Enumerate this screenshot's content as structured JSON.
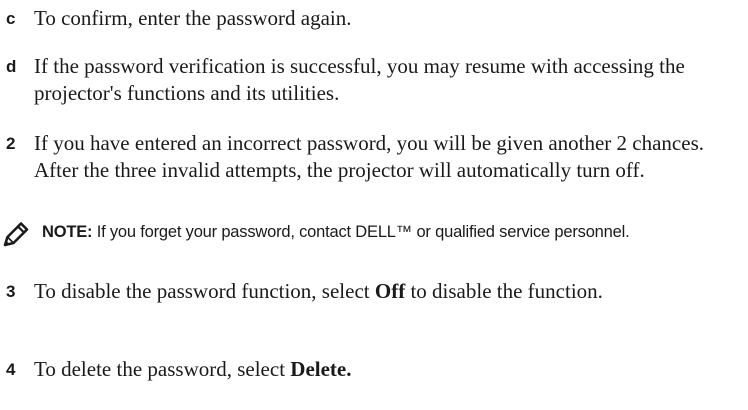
{
  "steps": [
    {
      "marker": "c",
      "text": "To confirm, enter the password again."
    },
    {
      "marker": "d",
      "text": "If the password verification is successful, you may resume with accessing the projector's functions and its utilities."
    },
    {
      "marker": "2",
      "text": "If you have entered an incorrect password, you will be given another 2 chances. After the three invalid attempts, the projector will automatically turn off."
    }
  ],
  "note": {
    "label": "NOTE:",
    "text": "If you forget your password, contact DELL™ or qualified service personnel."
  },
  "step3": {
    "marker": "3",
    "before": "To disable the password function, select ",
    "bold": "Off",
    "after": " to disable the function."
  },
  "step4": {
    "marker": "4",
    "before": "To delete the password, select ",
    "bold": "Delete."
  }
}
